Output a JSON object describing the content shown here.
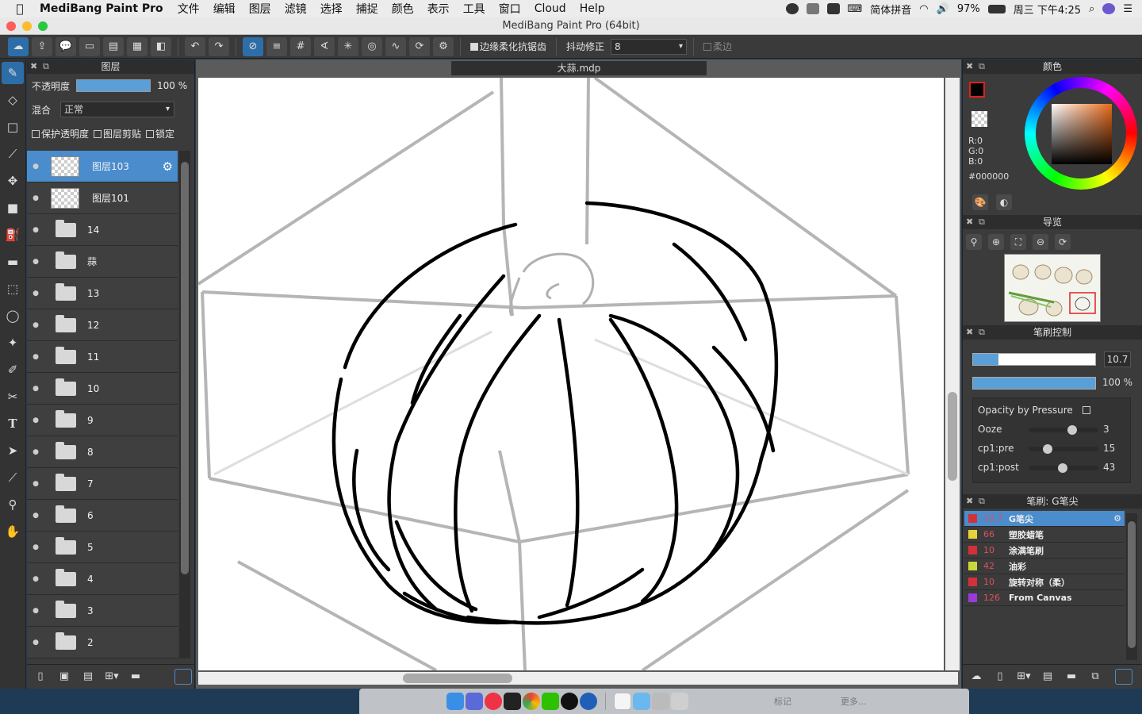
{
  "menubar": {
    "app_name": "MediBang Paint Pro",
    "items": [
      "文件",
      "编辑",
      "图层",
      "滤镜",
      "选择",
      "捕捉",
      "颜色",
      "表示",
      "工具",
      "窗口",
      "Cloud",
      "Help"
    ],
    "input_method": "简体拼音",
    "battery": "97%",
    "clock": "周三 下午4:25"
  },
  "window": {
    "title": "MediBang Paint Pro (64bit)"
  },
  "toolbar": {
    "antialias_label": "边缘柔化抗锯齿",
    "stabilizer_label": "抖动修正",
    "stabilizer_value": "8",
    "soft_edge_label": "柔边"
  },
  "layers_panel": {
    "title": "图层",
    "opacity_label": "不透明度",
    "opacity_value": "100 %",
    "blend_label": "混合",
    "blend_value": "正常",
    "protect_alpha": "保护透明度",
    "clipping": "图层剪贴",
    "lock": "锁定",
    "layers": [
      {
        "name": "图层103",
        "kind": "layer",
        "selected": true
      },
      {
        "name": "图层101",
        "kind": "layer"
      },
      {
        "name": "14",
        "kind": "folder"
      },
      {
        "name": "蒜",
        "kind": "folder"
      },
      {
        "name": "13",
        "kind": "folder"
      },
      {
        "name": "12",
        "kind": "folder"
      },
      {
        "name": "11",
        "kind": "folder"
      },
      {
        "name": "10",
        "kind": "folder"
      },
      {
        "name": "9",
        "kind": "folder"
      },
      {
        "name": "8",
        "kind": "folder"
      },
      {
        "name": "7",
        "kind": "folder"
      },
      {
        "name": "6",
        "kind": "folder"
      },
      {
        "name": "5",
        "kind": "folder"
      },
      {
        "name": "4",
        "kind": "folder"
      },
      {
        "name": "3",
        "kind": "folder"
      },
      {
        "name": "2",
        "kind": "folder"
      }
    ]
  },
  "canvas": {
    "document_tab": "大蒜.mdp"
  },
  "color_panel": {
    "title": "颜色",
    "r": "R:0",
    "g": "G:0",
    "b": "B:0",
    "hex": "#000000",
    "fg_color": "#000000",
    "accent": "#4a8ccc"
  },
  "navigator": {
    "title": "导览"
  },
  "brush_control": {
    "title": "笔刷控制",
    "size_value": "10.7",
    "size_fraction": 0.21,
    "opacity_value": "100 %",
    "opacity_fraction": 1.0,
    "opacity_by_pressure": "Opacity by Pressure",
    "params": [
      {
        "label": "Ooze",
        "value": "3",
        "fraction": 0.6
      },
      {
        "label": "cp1:pre",
        "value": "15",
        "fraction": 0.22
      },
      {
        "label": "cp1:post",
        "value": "43",
        "fraction": 0.45
      }
    ]
  },
  "brush_list": {
    "title": "笔刷: G笔尖",
    "items": [
      {
        "size": "10.7",
        "name": "G笔尖",
        "color": "#d2313a",
        "selected": true
      },
      {
        "size": "66",
        "name": "塑胶蜡笔",
        "color": "#e8d23a"
      },
      {
        "size": "10",
        "name": "涂满笔刷",
        "color": "#d2313a"
      },
      {
        "size": "42",
        "name": "油彩",
        "color": "#c8d83a"
      },
      {
        "size": "10",
        "name": "旋转对称（柔）",
        "color": "#d2313a"
      },
      {
        "size": "126",
        "name": "From Canvas",
        "color": "#9a3ad8"
      }
    ]
  },
  "dock": {
    "label_1": "标记",
    "label_2": "更多..."
  }
}
